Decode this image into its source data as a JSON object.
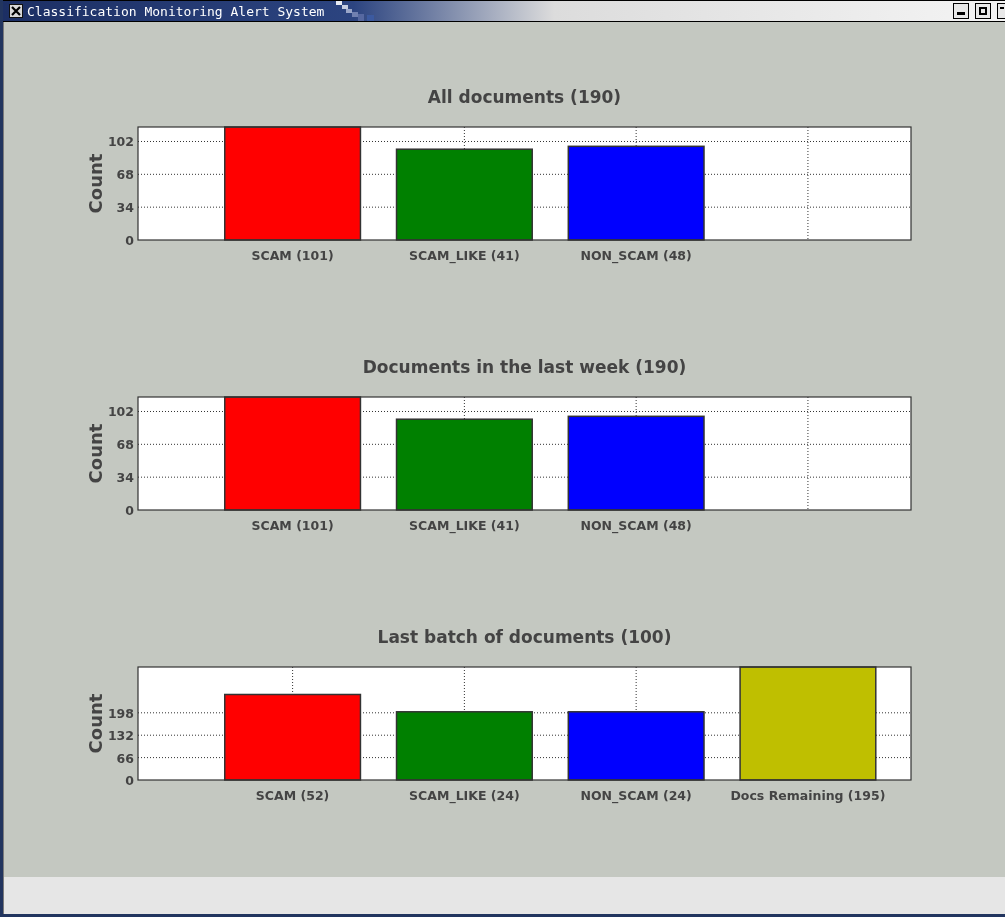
{
  "window": {
    "title": "Classification Monitoring Alert System"
  },
  "charts": [
    {
      "chart_data": {
        "type": "bar",
        "title": "All documents (190)",
        "ylabel": "Count",
        "categories": [
          "SCAM (101)",
          "SCAM_LIKE (41)",
          "NON_SCAM (48)"
        ],
        "values": [
          117,
          94,
          97
        ],
        "colors": [
          "#ff0000",
          "#008000",
          "#0000ff"
        ],
        "ylim": [
          0,
          117
        ],
        "yticks": [
          0,
          34,
          68,
          102
        ],
        "grid": true
      }
    },
    {
      "chart_data": {
        "type": "bar",
        "title": "Documents in the last week (190)",
        "ylabel": "Count",
        "categories": [
          "SCAM (101)",
          "SCAM_LIKE (41)",
          "NON_SCAM (48)"
        ],
        "values": [
          117,
          94,
          97
        ],
        "colors": [
          "#ff0000",
          "#008000",
          "#0000ff"
        ],
        "ylim": [
          0,
          117
        ],
        "yticks": [
          0,
          34,
          68,
          102
        ],
        "grid": true
      }
    },
    {
      "chart_data": {
        "type": "bar",
        "title": "Last batch of documents (100)",
        "ylabel": "Count",
        "categories": [
          "SCAM (52)",
          "SCAM_LIKE (24)",
          "NON_SCAM (24)",
          "Docs Remaining (195)"
        ],
        "values": [
          252,
          201,
          201,
          333
        ],
        "colors": [
          "#ff0000",
          "#008000",
          "#0000ff",
          "#bfbf00"
        ],
        "ylim": [
          0,
          333
        ],
        "yticks": [
          0,
          66,
          132,
          198
        ],
        "grid": true
      }
    }
  ]
}
